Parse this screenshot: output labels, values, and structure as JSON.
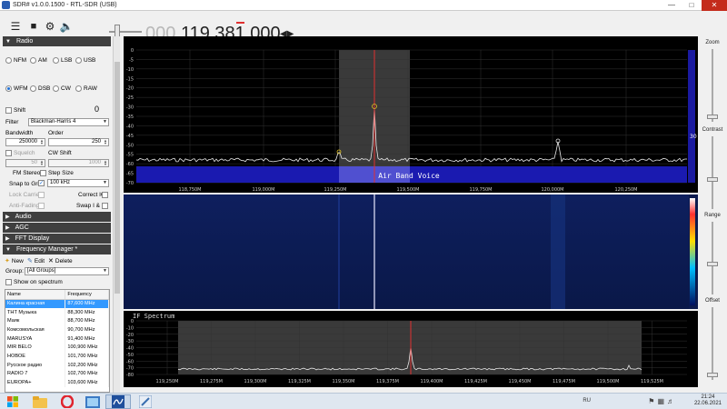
{
  "window": {
    "title": "SDR# v1.0.0.1500 - RTL-SDR (USB)"
  },
  "toolbar": {
    "frequency_dim": "000.",
    "frequency_main": "119.38",
    "frequency_cursor_digit": "1",
    "frequency_tail": ".000"
  },
  "radio": {
    "header": "Radio",
    "modes_row1": [
      "NFM",
      "AM",
      "LSB",
      "USB"
    ],
    "modes_row2": [
      "WFM",
      "DSB",
      "CW",
      "RAW"
    ],
    "selected_mode": "WFM",
    "shift_label": "Shift",
    "shift_value": "0",
    "filter_label": "Filter",
    "filter_value": "Blackman-Harris 4",
    "bandwidth_label": "Bandwidth",
    "bandwidth_value": "250000",
    "order_label": "Order",
    "order_value": "250",
    "squelch_label": "Squelch",
    "squelch_value": "50",
    "cw_shift_label": "CW Shift",
    "cw_shift_value": "1000",
    "fm_stereo_label": "FM Stereo",
    "step_size_label": "Step Size",
    "snap_label": "Snap to Grid",
    "snap_value": "100 kHz",
    "lock_carrier_label": "Lock Carrier",
    "correct_iq_label": "Correct IQ",
    "anti_fading_label": "Anti-Fading",
    "swap_iq_label": "Swap I & Q"
  },
  "sections": {
    "audio": "Audio",
    "agc": "AGC",
    "fft": "FFT Display",
    "freq_manager": "Frequency Manager *"
  },
  "freq_manager": {
    "new_label": "New",
    "edit_label": "Edit",
    "delete_label": "Delete",
    "group_label": "Group:",
    "group_value": "[All Groups]",
    "show_on_spectrum": "Show on spectrum",
    "columns": [
      "Name",
      "Frequency"
    ],
    "rows": [
      [
        "Калина красная",
        "87,600 MHz"
      ],
      [
        "ТНТ Музыка",
        "88,300 MHz"
      ],
      [
        "Маяк",
        "88,700 MHz"
      ],
      [
        "Комсомольская",
        "90,700 MHz"
      ],
      [
        "MARUSYA",
        "91,400 MHz"
      ],
      [
        "MIR BELO",
        "100,900 MHz"
      ],
      [
        "НОВОЕ",
        "101,700 MHz"
      ],
      [
        "Русское радио",
        "102,200 MHz"
      ],
      [
        "RADIO 7",
        "102,700 MHz"
      ],
      [
        "EUROPA+",
        "103,600 MHz"
      ]
    ],
    "selected_row": 0
  },
  "spectrum": {
    "db_ticks": [
      "0",
      "-5",
      "-10",
      "-15",
      "-20",
      "-25",
      "-30",
      "-35",
      "-40",
      "-45",
      "-50",
      "-55",
      "-60",
      "-65",
      "-70"
    ],
    "freq_ticks": [
      "119,000M",
      "119,250M",
      "119,500M",
      "119,750M",
      "120,000M",
      "120,250M"
    ],
    "freq_tick0": "118,750M",
    "band_label": "Air Band Voice",
    "right_value": "30"
  },
  "if_spectrum": {
    "title": "IF Spectrum",
    "db_ticks": [
      "0",
      "-10",
      "-20",
      "-30",
      "-40",
      "-50",
      "-60",
      "-70",
      "-80"
    ],
    "freq_ticks": [
      "119,250M",
      "119,275M",
      "119,300M",
      "119,325M",
      "119,350M",
      "119,375M",
      "119,400M",
      "119,425M",
      "119,450M",
      "119,475M",
      "119,500M",
      "119,525M"
    ]
  },
  "right_panel": {
    "zoom": "Zoom",
    "contrast": "Contrast",
    "range": "Range",
    "offset": "Offset"
  },
  "taskbar": {
    "lang": "RU",
    "time": "21:24",
    "date": "22.06.2021"
  },
  "colors": {
    "accent": "#1d6fd6",
    "band_fill": "#1a1ab0",
    "selection": "#3399ff",
    "signal_red": "#e03030"
  }
}
